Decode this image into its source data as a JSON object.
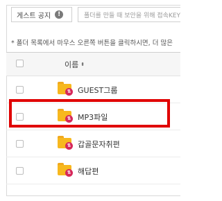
{
  "notice": {
    "label": "게스트 공지",
    "info_icon": "!",
    "text": "폴더를 만들 때 보안을 위해 접속KEY를"
  },
  "hint": "* 폴더 목록에서 마우스 오른쪽 버튼을 클릭하시면, 더 많은",
  "table": {
    "column_name": "이름",
    "sort_icon": "⬍",
    "rows": [
      {
        "label": "GUEST그룹"
      },
      {
        "label": "MP3파일"
      },
      {
        "label": "갑골문자취편"
      },
      {
        "label": "해답편"
      }
    ]
  },
  "colors": {
    "highlight": "#e00000",
    "folder": "#f7b81e",
    "share_badge": "#d6285a"
  }
}
